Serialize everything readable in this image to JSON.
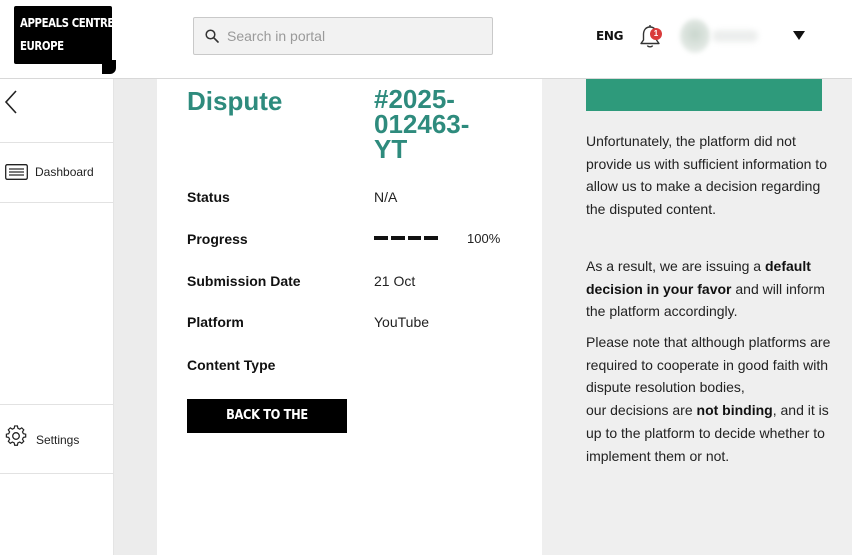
{
  "header": {
    "logo_line1": "APPEALS CENTRE",
    "logo_line2": "EUROPE",
    "search_placeholder": "Search in portal",
    "language": "ENG",
    "notification_count": "1"
  },
  "sidebar": {
    "items": [
      {
        "label": "Dashboard",
        "icon": "list-icon"
      },
      {
        "label": "Settings",
        "icon": "gear-icon"
      }
    ]
  },
  "dispute": {
    "title": "Dispute",
    "id_line1": "#2025-",
    "id_line2": "012463-",
    "id_line3": "YT",
    "status_label": "Status",
    "status_value": "N/A",
    "progress_label": "Progress",
    "progress_value": "100%",
    "progress_fraction": 1.0,
    "submission_label": "Submission Date",
    "submission_value": "21 Oct",
    "platform_label": "Platform",
    "platform_value": "YouTube",
    "content_type_label": "Content Type",
    "back_button": "BACK TO THE LISTINGS"
  },
  "decision": {
    "accent_color": "#2e9a7b",
    "para1": "Unfortunately, the platform did not provide us with sufficient information to allow us to make a decision regarding the disputed content.",
    "para2_a": "As a result, we are issuing a ",
    "para2_b": "default decision in your favor",
    "para2_c": " and will inform the platform accordingly.",
    "para3_a": "Please note that although platforms are required to cooperate in good faith with dispute resolution bodies,",
    "para3_b": "our decisions are ",
    "para3_c": "not binding",
    "para3_d": ", and it is up to the platform to decide whether to implement them or not."
  },
  "colors": {
    "brand_green": "#2e8b7d",
    "badge_red": "#d93b3b"
  }
}
